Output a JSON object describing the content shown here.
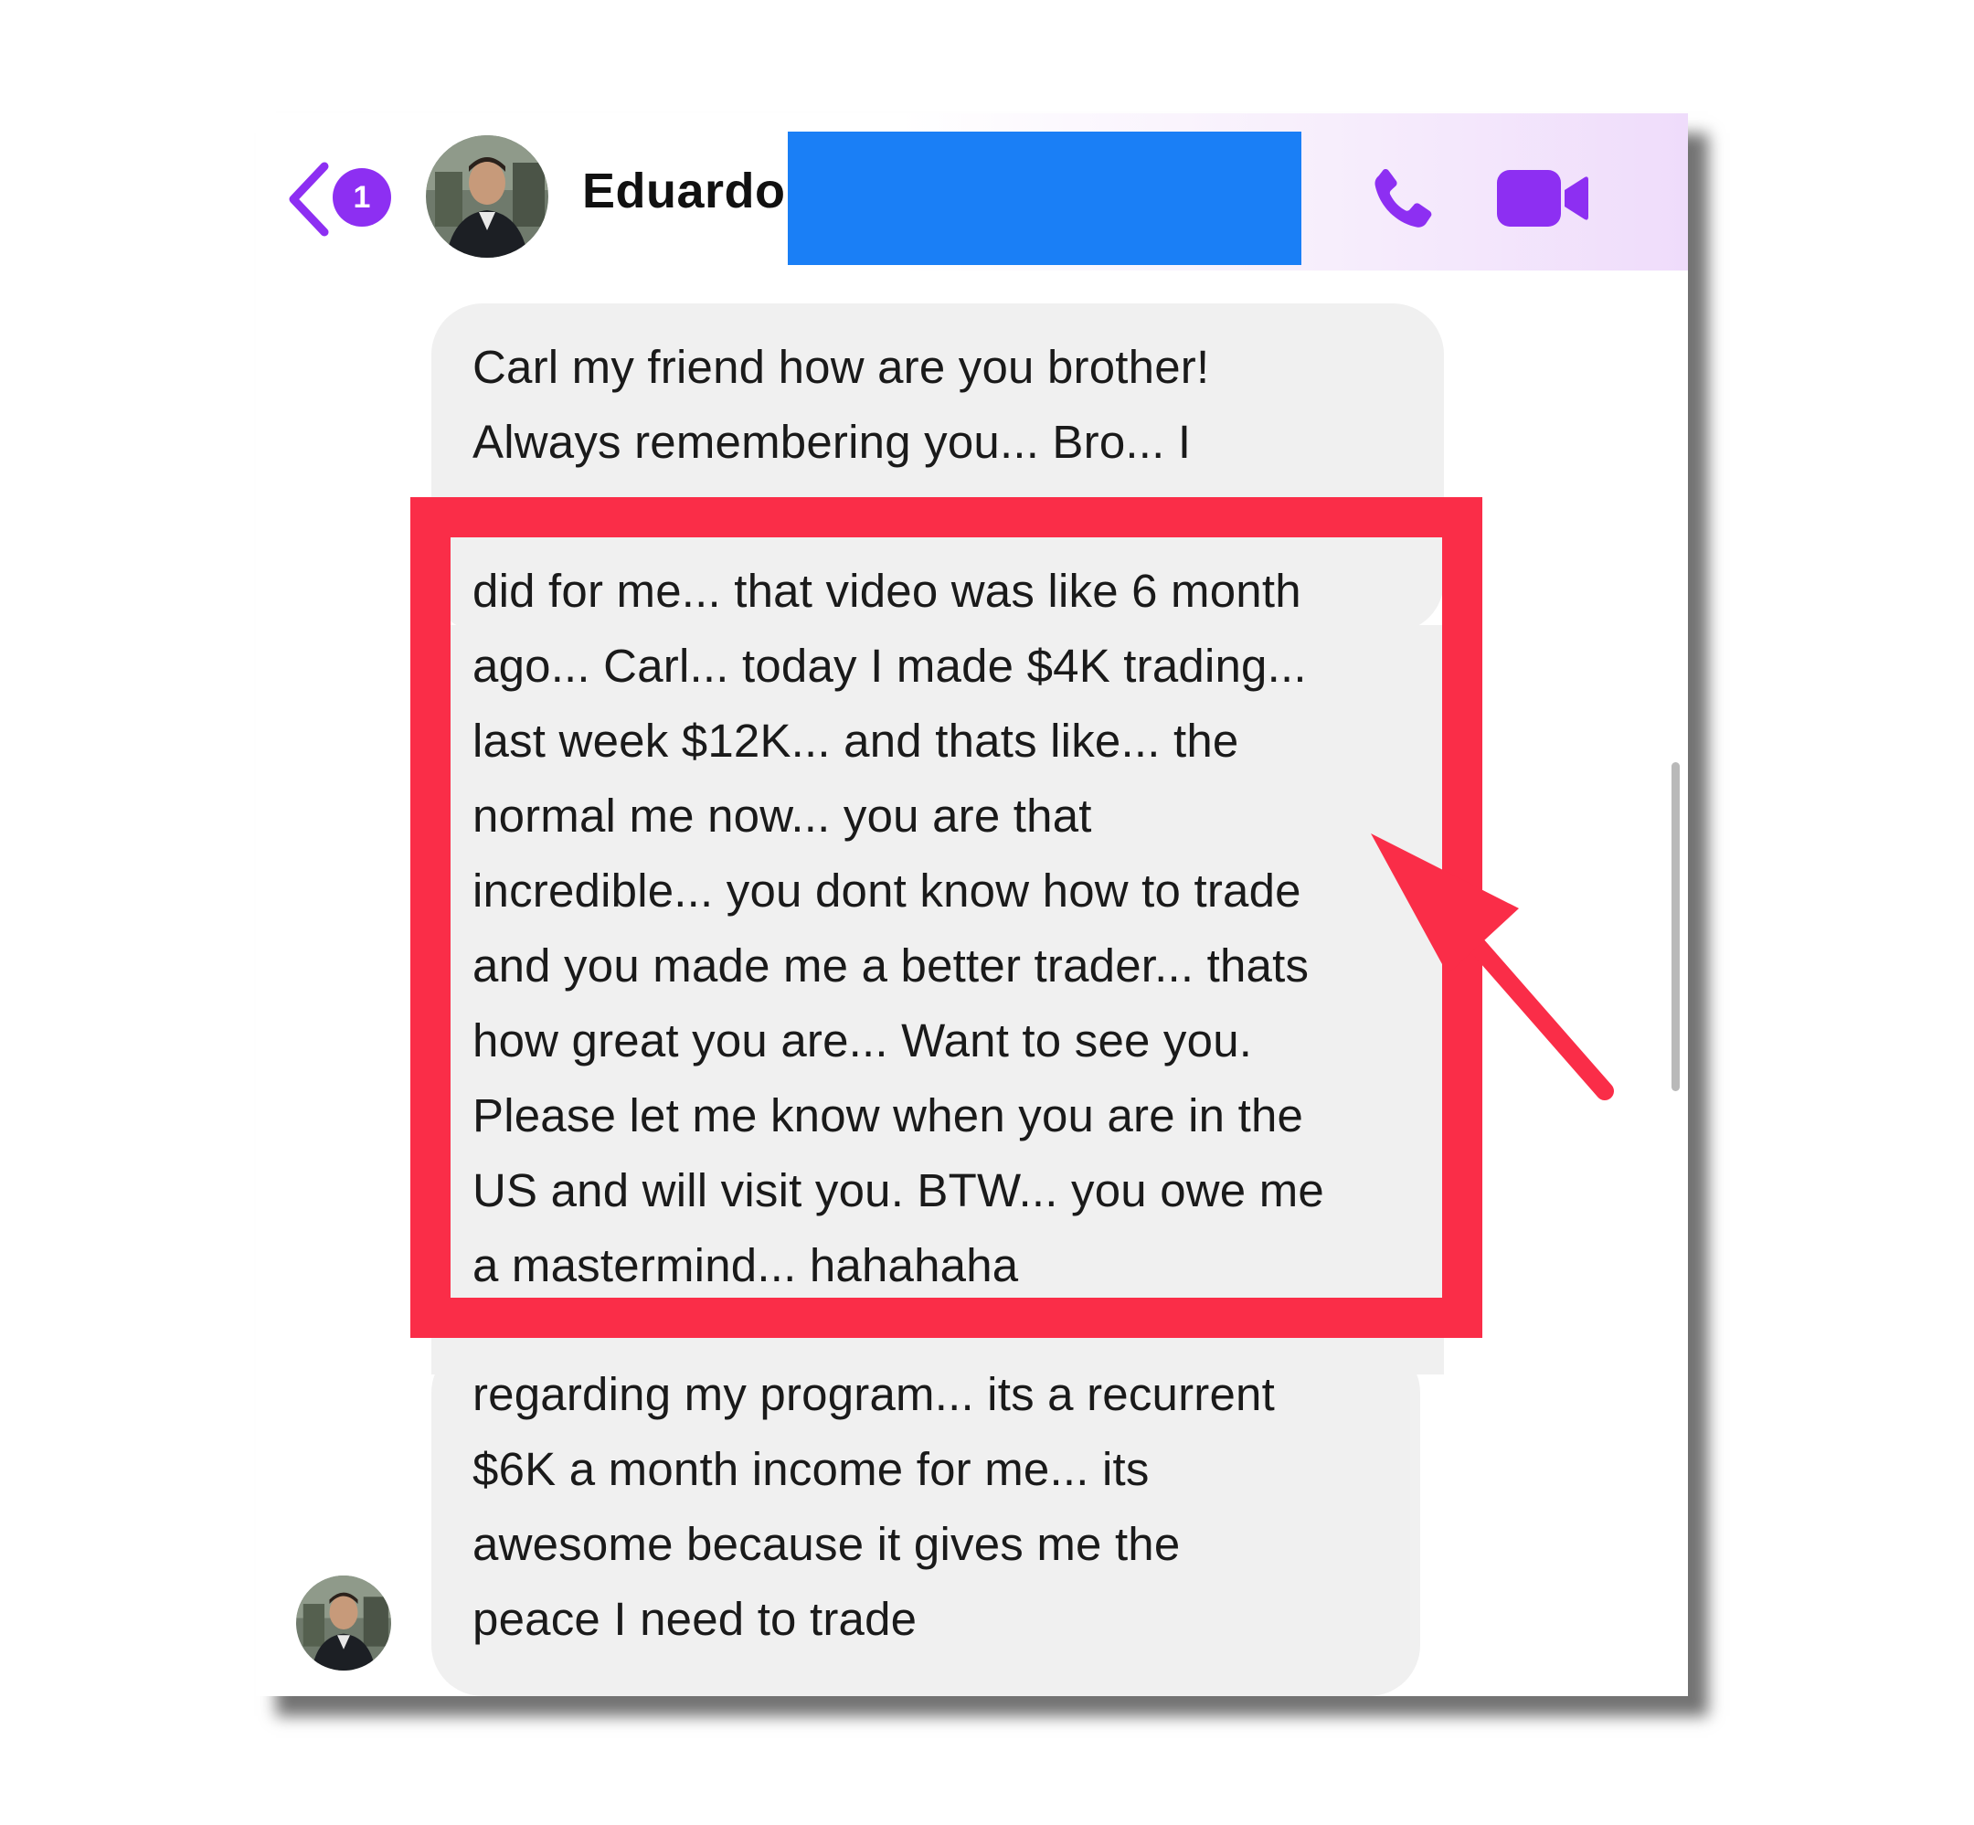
{
  "header": {
    "back_label": "Back",
    "unread_count": "1",
    "contact_name": "Eduardo"
  },
  "messages": [
    {
      "lines": [
        "Carl my friend how are you brother!",
        "Always remembering you... Bro... I"
      ]
    },
    {
      "lines": [
        "did for me... that video was like 6 month",
        "ago... Carl... today I made $4K trading...",
        "last week $12K... and thats like... the",
        "normal me now... you are that",
        "incredible... you dont know how to trade",
        "and you made me a better trader... thats",
        "how great you are... Want to see you.",
        "Please let me know when you are in the",
        "US and will visit you. BTW... you owe me",
        "a mastermind... hahahaha"
      ]
    },
    {
      "lines": [
        "regarding my program... its a recurrent",
        "$6K a month  income for me... its",
        "awesome because it gives me the",
        "peace I need to trade"
      ]
    }
  ],
  "colors": {
    "accent": "#8d2ff2",
    "redaction": "#1a7ff6",
    "highlight": "#fa2d48",
    "bubble": "#f0f0f0"
  },
  "icons": {
    "back": "chevron-left-icon",
    "call": "phone-icon",
    "video": "video-camera-icon",
    "annotation": "arrow-icon"
  }
}
